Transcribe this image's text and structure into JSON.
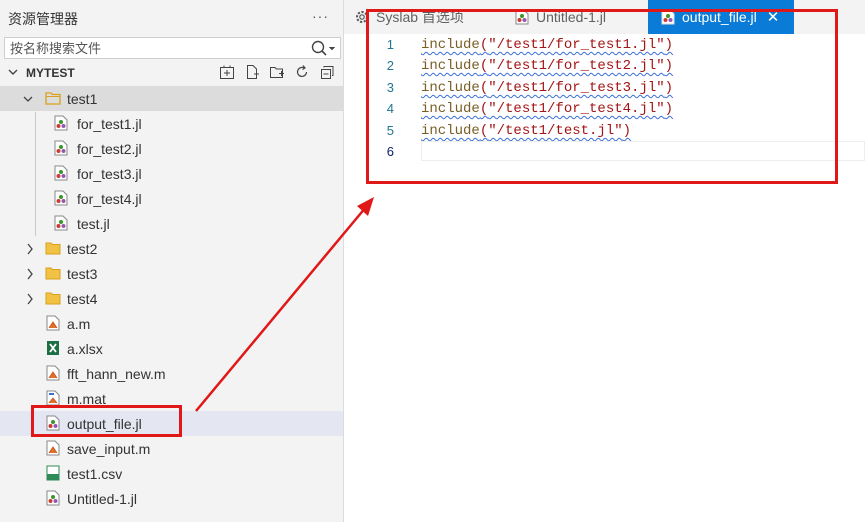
{
  "sidebar": {
    "title": "资源管理器",
    "more_label": "···",
    "search": {
      "placeholder": "按名称搜索文件",
      "value": ""
    },
    "section": {
      "title": "MYTEST",
      "actions": [
        "new-file-from-template-icon",
        "new-file-icon",
        "new-folder-icon",
        "refresh-icon",
        "collapse-all-icon"
      ]
    },
    "tree": [
      {
        "label": "test1",
        "type": "folder",
        "expanded": true,
        "level": 0
      },
      {
        "label": "for_test1.jl",
        "type": "julia",
        "level": 1
      },
      {
        "label": "for_test2.jl",
        "type": "julia",
        "level": 1
      },
      {
        "label": "for_test3.jl",
        "type": "julia",
        "level": 1
      },
      {
        "label": "for_test4.jl",
        "type": "julia",
        "level": 1
      },
      {
        "label": "test.jl",
        "type": "julia",
        "level": 1
      },
      {
        "label": "test2",
        "type": "folder",
        "expanded": false,
        "level": 0
      },
      {
        "label": "test3",
        "type": "folder",
        "expanded": false,
        "level": 0
      },
      {
        "label": "test4",
        "type": "folder",
        "expanded": false,
        "level": 0
      },
      {
        "label": "a.m",
        "type": "matlab",
        "level": 0
      },
      {
        "label": "a.xlsx",
        "type": "excel",
        "level": 0
      },
      {
        "label": "fft_hann_new.m",
        "type": "matlab",
        "level": 0
      },
      {
        "label": "m.mat",
        "type": "mat",
        "level": 0
      },
      {
        "label": "output_file.jl",
        "type": "julia",
        "level": 0
      },
      {
        "label": "save_input.m",
        "type": "matlab",
        "level": 0
      },
      {
        "label": "test1.csv",
        "type": "csv",
        "level": 0
      },
      {
        "label": "Untitled-1.jl",
        "type": "julia",
        "level": 0
      }
    ]
  },
  "tabs": [
    {
      "label": "Syslab 首选项",
      "icon": "gear-icon",
      "active": false
    },
    {
      "label": "Untitled-1.jl",
      "icon": "julia-file-icon",
      "active": false
    },
    {
      "label": "output_file.jl",
      "icon": "julia-file-icon",
      "active": true,
      "close": "✕"
    }
  ],
  "editor": {
    "lines": [
      {
        "num": "1",
        "fn": "include",
        "open": "(",
        "str": "\"/test1/for_test1.jl\"",
        "close": ")"
      },
      {
        "num": "2",
        "fn": "include",
        "open": "(",
        "str": "\"/test1/for_test2.jl\"",
        "close": ")"
      },
      {
        "num": "3",
        "fn": "include",
        "open": "(",
        "str": "\"/test1/for_test3.jl\"",
        "close": ")"
      },
      {
        "num": "4",
        "fn": "include",
        "open": "(",
        "str": "\"/test1/for_test4.jl\"",
        "close": ")"
      },
      {
        "num": "5",
        "fn": "include",
        "open": "(",
        "str": "\"/test1/test.jl\"",
        "close": ")"
      },
      {
        "num": "6",
        "fn": "",
        "open": "",
        "str": "",
        "close": ""
      }
    ]
  },
  "colors": {
    "accent": "#0a7bd6",
    "annotation": "#e01818",
    "folder": "#e8b730",
    "julia_red": "#cb3c33",
    "julia_green": "#389826",
    "julia_purple": "#9558b2",
    "excel_green": "#1d7044",
    "matlab_orange": "#e1702a"
  }
}
